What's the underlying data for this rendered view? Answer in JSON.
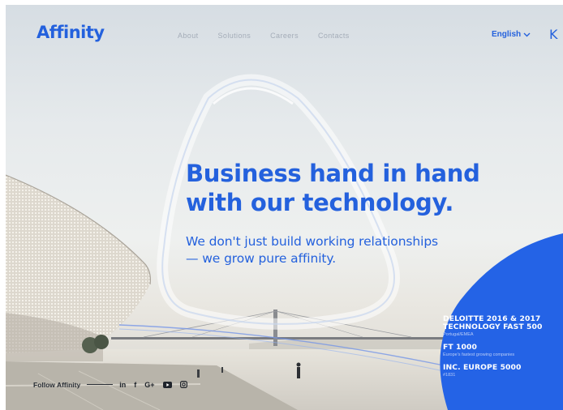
{
  "header": {
    "logo": "Affinity",
    "nav": [
      "About",
      "Solutions",
      "Careers",
      "Contacts"
    ],
    "language": "English",
    "right_mark": "K"
  },
  "hero": {
    "headline_line1": "Business hand in hand",
    "headline_line2": "with our technology.",
    "sub_line1": "We don't just build working relationships",
    "sub_line2": "— we grow pure affinity."
  },
  "follow": {
    "label": "Follow Affinity",
    "icons": [
      "linkedin-icon",
      "facebook-icon",
      "google-plus-icon",
      "youtube-icon",
      "instagram-icon"
    ],
    "linkedin_text": "in",
    "facebook_text": "f",
    "google_text": "G+"
  },
  "awards": [
    {
      "title_line1": "DELOITTE 2016 & 2017",
      "title_line2": "TECHNOLOGY FAST 500",
      "sub": "Portugal/EMEA"
    },
    {
      "title_line1": "FT 1000",
      "title_line2": "",
      "sub": "Europe's fastest growing companies"
    },
    {
      "title_line1": "INC. EUROPE 5000",
      "title_line2": "",
      "sub": "#1831"
    }
  ],
  "colors": {
    "brand_blue": "#2461dd",
    "nav_gray": "#a4acb8",
    "blob_blue": "#2463e6"
  }
}
